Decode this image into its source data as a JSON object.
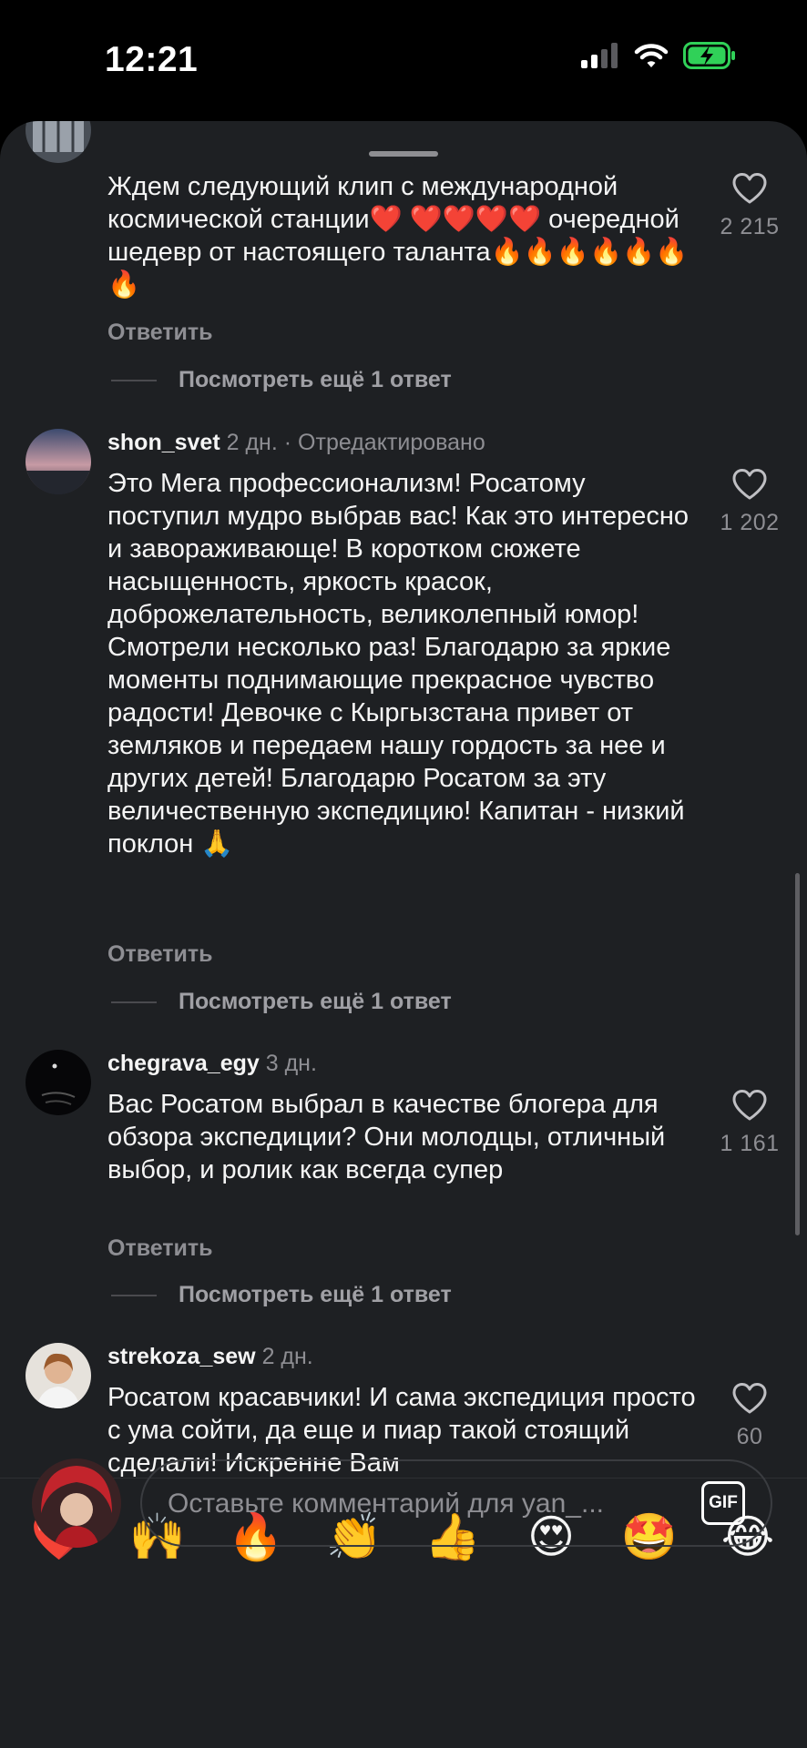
{
  "status_bar": {
    "time": "12:21"
  },
  "comments": [
    {
      "username": "",
      "time": "",
      "edited": "",
      "text": "Ждем следующий клип с международной космической станции❤️ ❤️❤️❤️❤️ очередной шедевр от настоящего таланта🔥🔥🔥🔥🔥🔥🔥",
      "reply_label": "Ответить",
      "likes": "2 215",
      "more_replies": "Посмотреть ещё 1 ответ"
    },
    {
      "username": "shon_svet",
      "time": "2 дн.",
      "edited": "· Отредактировано",
      "text": "Это Мега профессионализм! Росатому поступил мудро выбрав вас! Как это интересно и завораживающе! В коротком сюжете насыщенность, яркость красок, доброжелательность, великолепный юмор! Смотрели несколько раз! Благодарю за яркие моменты поднимающие прекрасное чувство радости! Девочке с Кыргызстана привет от земляков и передаем нашу гордость за нее и других детей! Благодарю Росатом за эту величественную экспедицию! Капитан - низкий поклон 🙏",
      "reply_label": "Ответить",
      "likes": "1 202",
      "more_replies": "Посмотреть ещё 1 ответ"
    },
    {
      "username": "chegrava_egy",
      "time": "3 дн.",
      "edited": "",
      "text": "Вас Росатом выбрал в качестве блогера для обзора экспедиции? Они молодцы, отличный выбор, и ролик как всегда супер",
      "reply_label": "Ответить",
      "likes": "1 161",
      "more_replies": "Посмотреть ещё 1 ответ"
    },
    {
      "username": "strekoza_sew",
      "time": "2 дн.",
      "edited": "",
      "text": "Росатом красавчики! И сама экспедиция просто с ума сойти, да еще и пиар такой стоящий сделали! Искренне Вам",
      "reply_label": "",
      "likes": "60",
      "more_replies": ""
    }
  ],
  "reactions": [
    "❤️",
    "🙌",
    "🔥",
    "👏",
    "👍",
    "😍",
    "🤩",
    "😂"
  ],
  "composer": {
    "placeholder": "Оставьте комментарий для yan_...",
    "gif_label": "GIF"
  },
  "colors": {
    "background": "#1e2023",
    "text": "#f5f5f5",
    "muted": "#8e8e93",
    "battery": "#30d158"
  }
}
